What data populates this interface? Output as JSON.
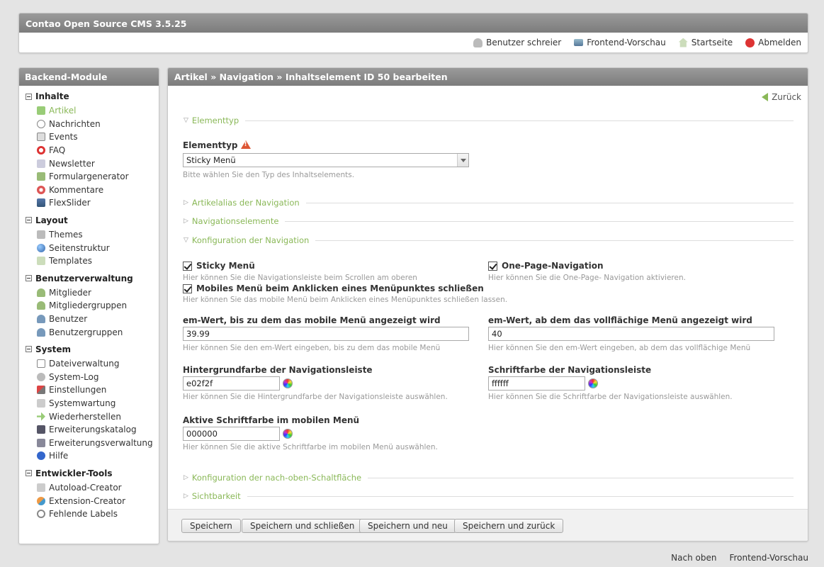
{
  "header": {
    "title": "Contao Open Source CMS 3.5.25",
    "links": {
      "user": "Benutzer schreier",
      "preview": "Frontend-Vorschau",
      "home": "Startseite",
      "logout": "Abmelden"
    }
  },
  "sidebar": {
    "title": "Backend-Module",
    "groups": [
      {
        "title": "Inhalte",
        "items": [
          "Artikel",
          "Nachrichten",
          "Events",
          "FAQ",
          "Newsletter",
          "Formulargenerator",
          "Kommentare",
          "FlexSlider"
        ]
      },
      {
        "title": "Layout",
        "items": [
          "Themes",
          "Seitenstruktur",
          "Templates"
        ]
      },
      {
        "title": "Benutzerverwaltung",
        "items": [
          "Mitglieder",
          "Mitgliedergruppen",
          "Benutzer",
          "Benutzergruppen"
        ]
      },
      {
        "title": "System",
        "items": [
          "Dateiverwaltung",
          "System-Log",
          "Einstellungen",
          "Systemwartung",
          "Wiederherstellen",
          "Erweiterungskatalog",
          "Erweiterungsverwaltung",
          "Hilfe"
        ]
      },
      {
        "title": "Entwickler-Tools",
        "items": [
          "Autoload-Creator",
          "Extension-Creator",
          "Fehlende Labels"
        ]
      }
    ]
  },
  "main": {
    "title": "Artikel » Navigation » Inhaltselement ID 50 bearbeiten",
    "back": "Zurück",
    "legends": {
      "elementtyp": "Elementtyp",
      "alias": "Artikelalias der Navigation",
      "elements": "Navigationselemente",
      "config": "Konfiguration der Navigation",
      "top_button": "Konfiguration der nach-oben-Schaltfläche",
      "visibility": "Sichtbarkeit"
    },
    "type_label": "Elementtyp",
    "type_value": "Sticky Menü",
    "type_hint": "Bitte wählen Sie den Typ des Inhaltselements.",
    "sticky_label": "Sticky Menü",
    "sticky_hint": "Hier können Sie die Navigationsleiste beim Scrollen am oberen",
    "onepage_label": "One-Page-Navigation",
    "onepage_hint": "Hier können Sie die One-Page- Navigation aktivieren.",
    "mobile_close_label": "Mobiles Menü beim Anklicken eines Menüpunktes schließen",
    "mobile_close_hint": "Hier können Sie das mobile Menü beim Anklicken eines Menüpunktes schließen lassen.",
    "em_mobile_label": "em-Wert, bis zu dem das mobile Menü angezeigt wird",
    "em_mobile_value": "39.99",
    "em_mobile_hint": "Hier können Sie den em-Wert eingeben, bis zu dem das mobile Menü",
    "em_full_label": "em-Wert, ab dem das vollflächige Menü angezeigt wird",
    "em_full_value": "40",
    "em_full_hint": "Hier können Sie den em-Wert eingeben, ab dem das vollflächige Menü",
    "bg_label": "Hintergrundfarbe der Navigationsleiste",
    "bg_value": "e02f2f",
    "bg_hint": "Hier können Sie die Hintergrundfarbe der Navigationsleiste auswählen.",
    "font_label": "Schriftfarbe der Navigationsleiste",
    "font_value": "ffffff",
    "font_hint": "Hier können Sie die Schriftfarbe der Navigationsleiste auswählen.",
    "active_label": "Aktive Schriftfarbe im mobilen Menü",
    "active_value": "000000",
    "active_hint": "Hier können Sie die aktive Schriftfarbe im mobilen Menü auswählen.",
    "buttons": {
      "save": "Speichern",
      "save_close": "Speichern und schließen",
      "save_new": "Speichern und neu",
      "save_back": "Speichern und zurück"
    }
  },
  "footer": {
    "top": "Nach oben",
    "preview": "Frontend-Vorschau"
  },
  "colors": {
    "accent": "#8ab858",
    "header": "#8a8a8a"
  }
}
